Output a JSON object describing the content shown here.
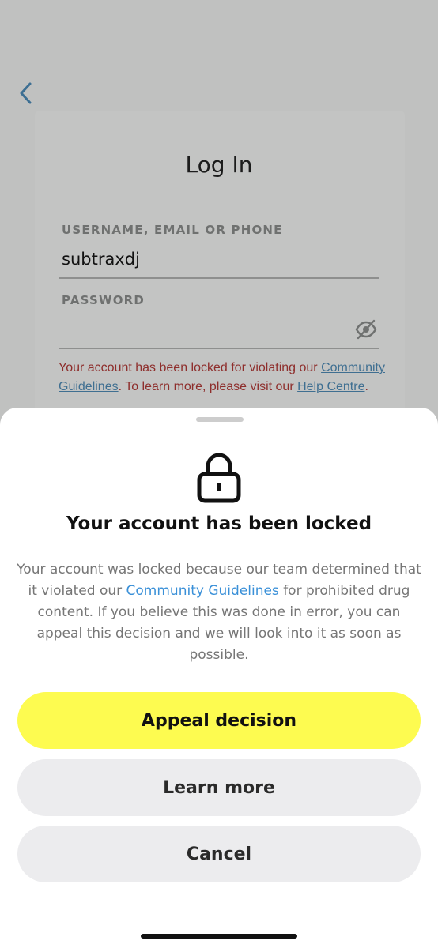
{
  "login": {
    "title": "Log In",
    "username_label": "USERNAME, EMAIL OR PHONE",
    "username_value": "subtraxdj",
    "password_label": "PASSWORD",
    "error": {
      "part1": "Your account has been locked for violating our ",
      "link1": "Community Guidelines",
      "part2": ". To learn more, please visit our ",
      "link2": "Help Centre",
      "part3": "."
    }
  },
  "sheet": {
    "title": "Your account has been locked",
    "body_part1": "Your account was locked because our team determined that it violated our ",
    "body_link": "Community Guidelines",
    "body_part2": " for prohibited drug content. If you believe this was done in error, you can appeal this decision and we will look into it as soon as possible.",
    "buttons": {
      "appeal": "Appeal decision",
      "learn_more": "Learn more",
      "cancel": "Cancel"
    }
  },
  "colors": {
    "accent_yellow": "#fdfb50",
    "link_blue": "#3a90d8",
    "error_red": "#8e2e2c"
  },
  "icons": {
    "back": "chevron-left-icon",
    "eye": "eye-off-icon",
    "lock": "lock-icon"
  }
}
